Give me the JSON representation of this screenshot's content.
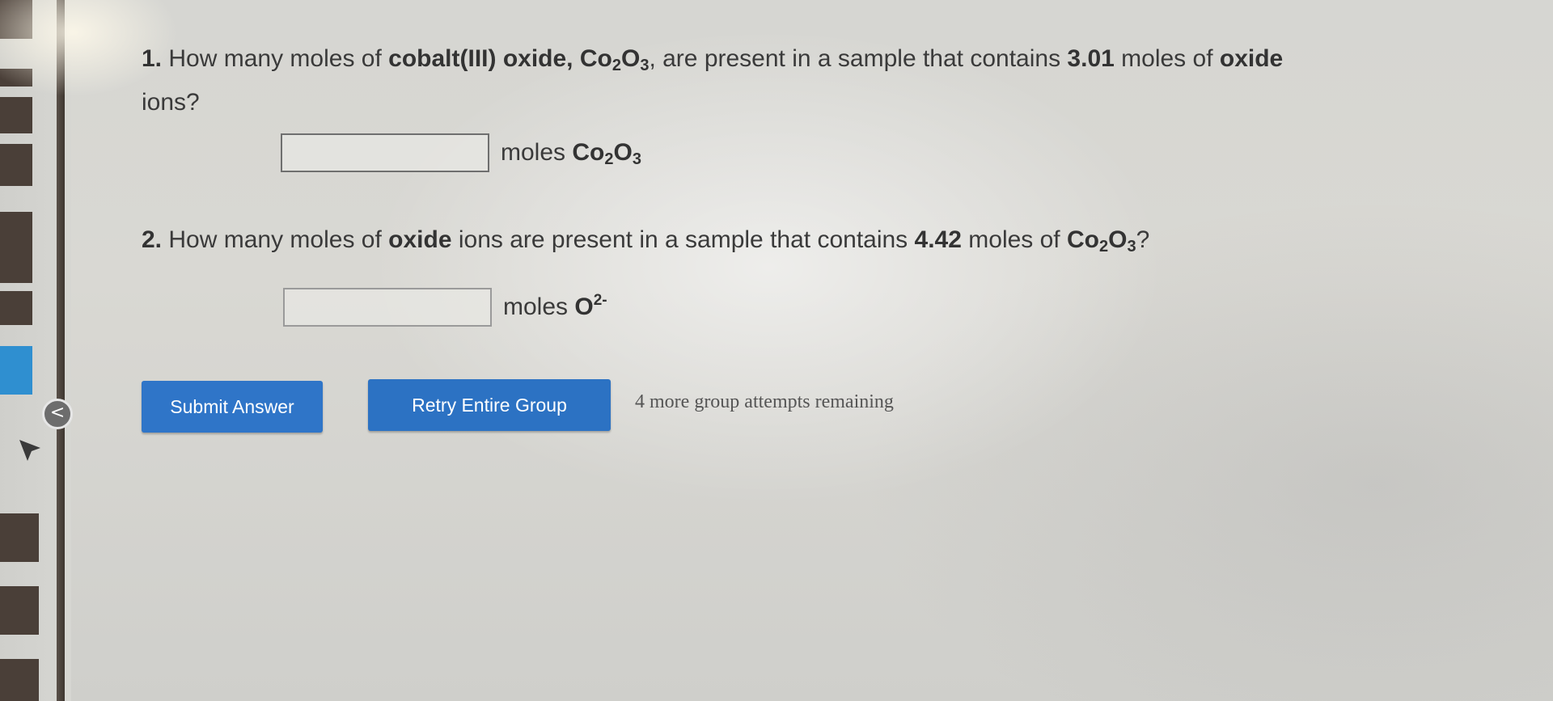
{
  "question1": {
    "number": "1.",
    "text_a": "How many moles of",
    "compound_name": "cobalt(III) oxide,",
    "formula_co": "Co",
    "formula_sub_co": "2",
    "formula_o": "O",
    "formula_sub_o": "3",
    "text_b": ", are present in a sample that contains",
    "amount": "3.01",
    "text_c": "moles of",
    "ion_word": "oxide",
    "text_d": "ions?",
    "input_value": "",
    "unit_text": "moles",
    "unit_co": "Co",
    "unit_sub_co": "2",
    "unit_o": "O",
    "unit_sub_o": "3"
  },
  "question2": {
    "number": "2.",
    "text_a": "How many moles of",
    "ion_word": "oxide",
    "text_b": "ions are present in a sample that contains",
    "amount": "4.42",
    "text_c": "moles of",
    "formula_co": "Co",
    "formula_sub_co": "2",
    "formula_o": "O",
    "formula_sub_o": "3",
    "text_d": "?",
    "input_value": "",
    "unit_text": "moles",
    "unit_ion": "O",
    "unit_charge": "2-"
  },
  "actions": {
    "submit_label": "Submit Answer",
    "retry_label": "Retry Entire Group",
    "attempts_text": "4 more group attempts remaining"
  },
  "sidebar": {
    "collapse_glyph": "<"
  },
  "colors": {
    "button_blue": "#2f75c8",
    "sidebar_blue": "#2f8fd0",
    "bezel_brown": "#4a3f38"
  }
}
